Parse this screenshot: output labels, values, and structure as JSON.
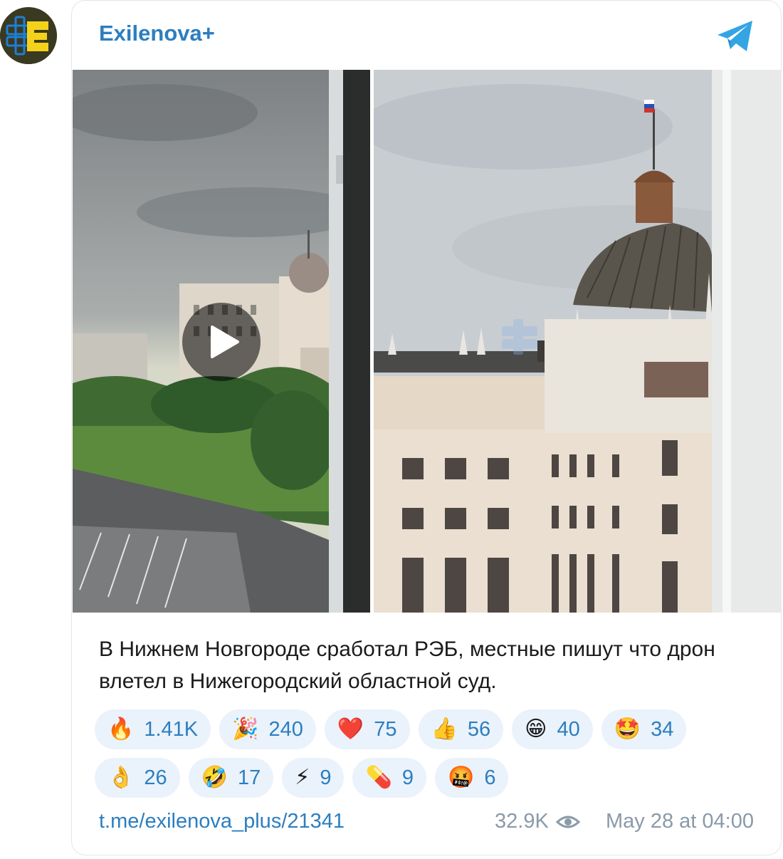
{
  "channel": {
    "name": "Exilenova+",
    "avatar_icon": "exilenova-logo-icon",
    "telegram_icon": "telegram-plane-icon"
  },
  "media": {
    "left_photo_icon": "play-icon",
    "watermark": "Exilenova"
  },
  "post": {
    "text": "В Нижнем Новгороде сработал РЭБ, местные пишут что дрон влетел в Нижегородский областной суд.",
    "link": "t.me/exilenova_plus/21341",
    "views": "32.9K",
    "views_icon": "eye-icon",
    "date": "May 28 at 04:00"
  },
  "reactions": {
    "row1": [
      {
        "emoji": "🔥",
        "count": "1.41K"
      },
      {
        "emoji": "🎉",
        "count": "240"
      },
      {
        "emoji": "❤️",
        "count": "75"
      },
      {
        "emoji": "👍",
        "count": "56"
      },
      {
        "emoji": "😁",
        "count": "40"
      },
      {
        "emoji": "🤩",
        "count": "34"
      }
    ],
    "row2": [
      {
        "emoji": "👌",
        "count": "26"
      },
      {
        "emoji": "🤣",
        "count": "17"
      },
      {
        "emoji": "⚡",
        "count": "9"
      },
      {
        "emoji": "💊",
        "count": "9"
      },
      {
        "emoji": "🤬",
        "count": "6"
      }
    ]
  },
  "colors": {
    "accent": "#2c7ec0",
    "reaction_bg": "#eaf2fb",
    "meta": "#8a9aa9"
  }
}
